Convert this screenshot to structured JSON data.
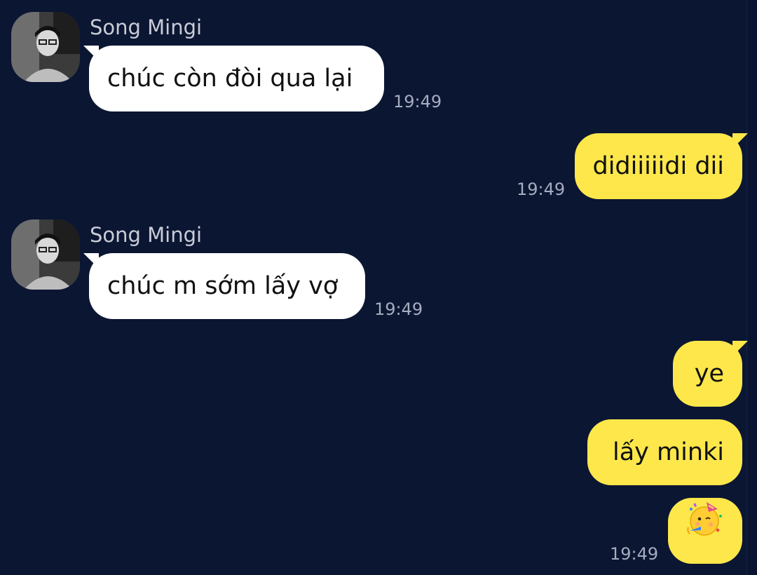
{
  "messages": [
    {
      "sender": "Song Mingi",
      "text": "chúc còn đòi qua lại",
      "time": "19:49"
    },
    {
      "text": "didiiiiidi dii",
      "time": "19:49"
    },
    {
      "sender": "Song Mingi",
      "text": "chúc m sớm lấy vợ",
      "time": "19:49"
    },
    {
      "text": "ye"
    },
    {
      "text": "lấy minki"
    },
    {
      "emoji": "partying-face-icon",
      "time": "19:49"
    }
  ],
  "colors": {
    "background": "#0b1633",
    "incoming_bubble": "#ffffff",
    "outgoing_bubble": "#fde74b",
    "timestamp": "#a6acbd",
    "sender_name": "#c9ccd6"
  }
}
